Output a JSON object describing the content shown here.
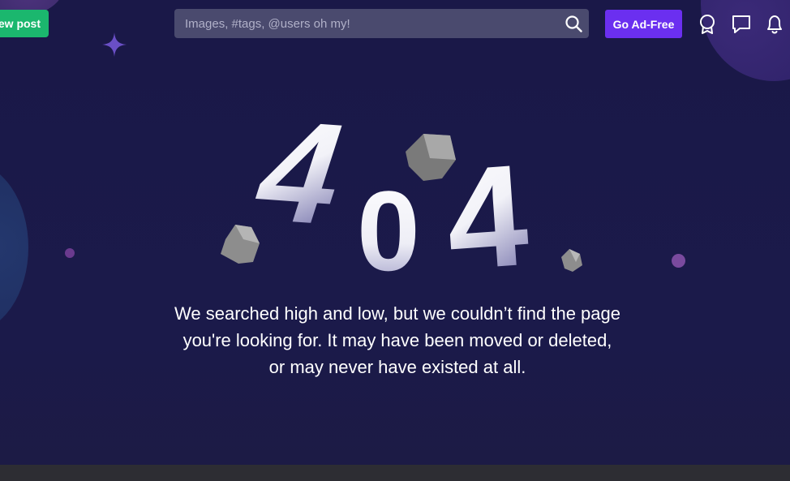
{
  "header": {
    "new_post_label": "ew post",
    "search": {
      "placeholder": "Images, #tags, @users oh my!",
      "value": ""
    },
    "ad_free_label": "Go Ad-Free"
  },
  "error": {
    "code_digits": [
      "4",
      "0",
      "4"
    ],
    "message_lines": [
      "We searched high and low, but we couldn’t find the page",
      "you're looking for. It may have been moved or deleted,",
      "or may never have existed at all."
    ]
  },
  "colors": {
    "background": "#1b1a4a",
    "new_post": "#1bb76e",
    "ad_free": "#6b2ff0",
    "search_bg": "#4a4a6e"
  },
  "icons": [
    "search-icon",
    "award-icon",
    "chat-icon",
    "bell-icon",
    "sparkle-icon",
    "rock-icon"
  ]
}
